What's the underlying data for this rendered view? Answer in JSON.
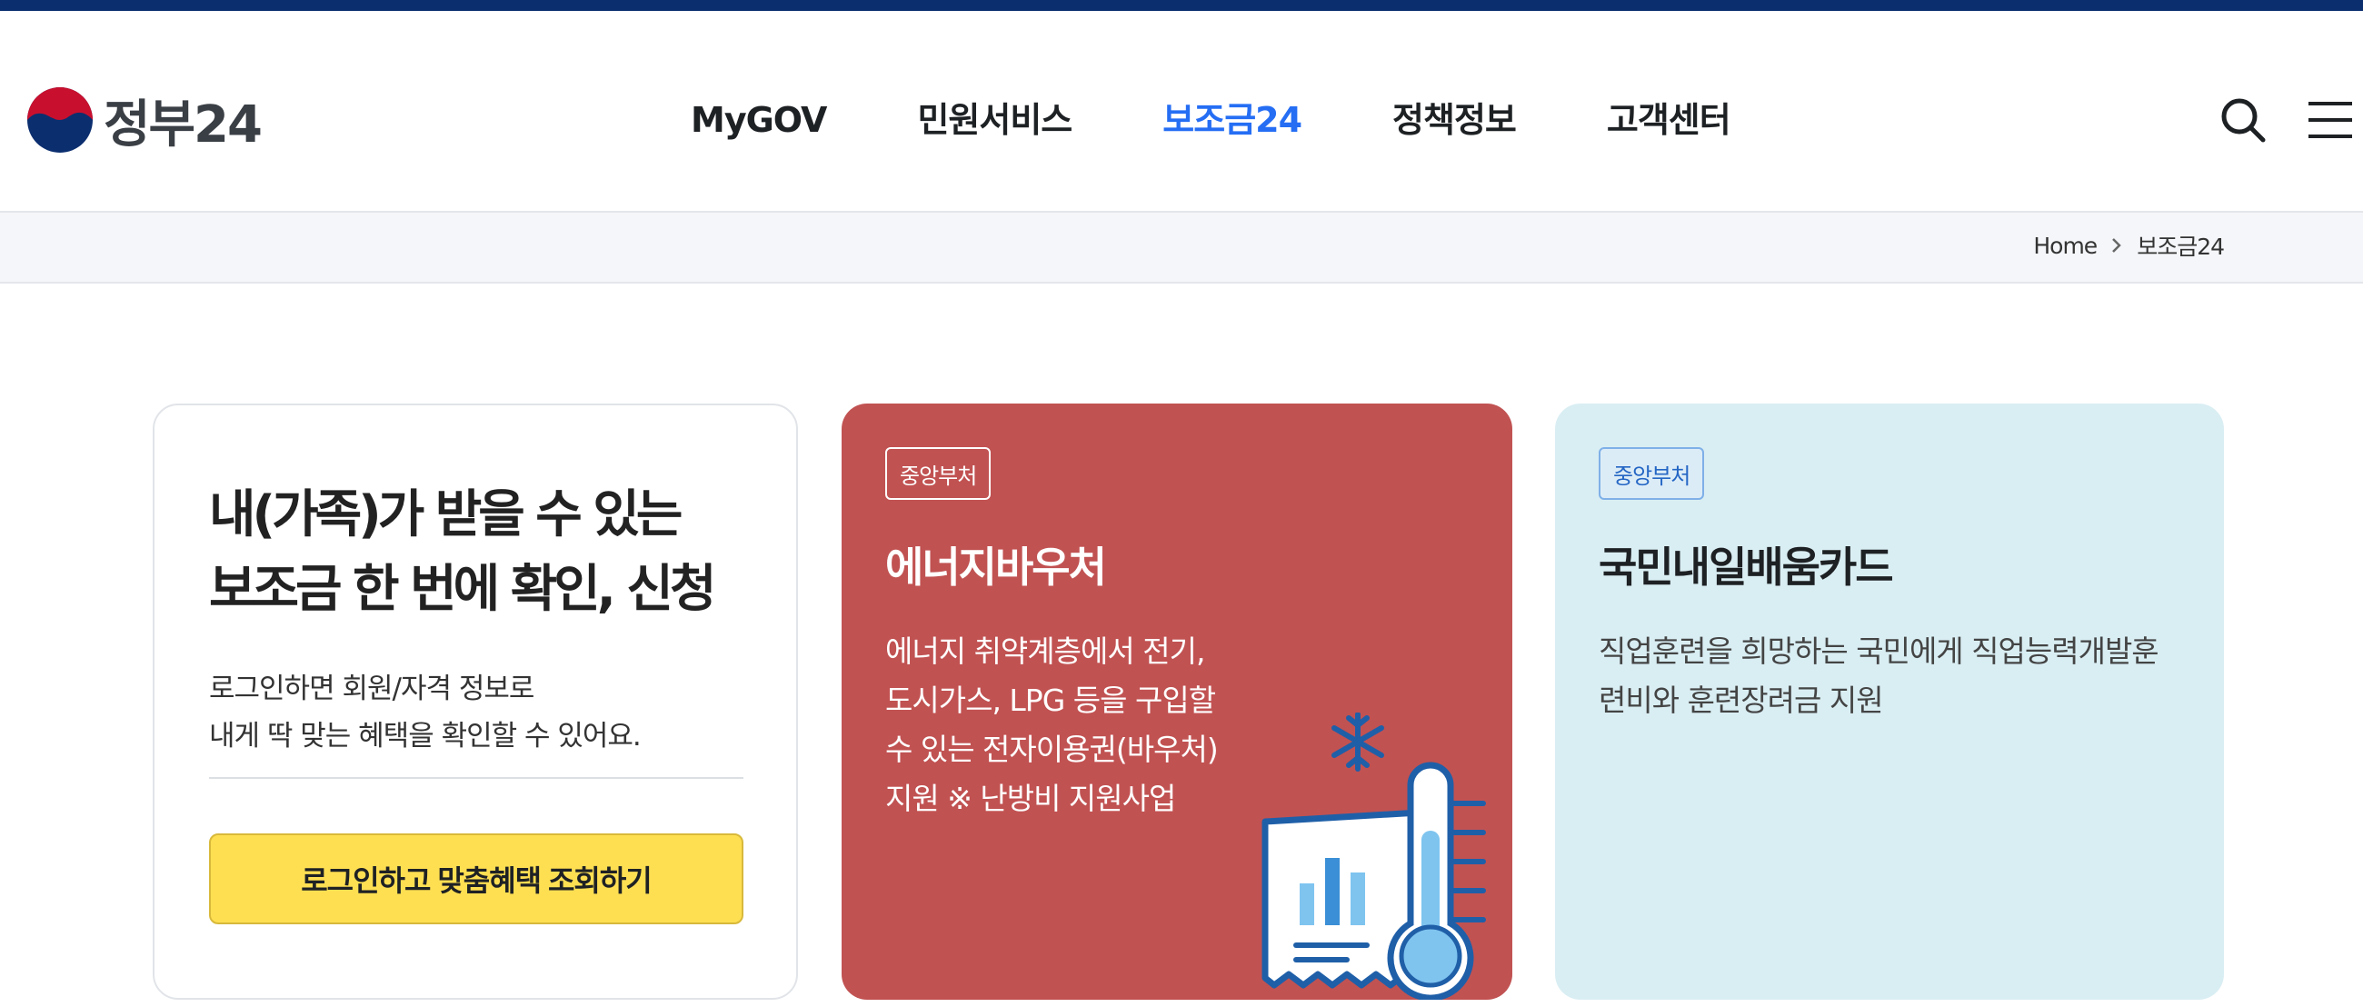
{
  "logo": {
    "text": "정부24",
    "icon": "government-emblem-icon"
  },
  "nav": {
    "items": [
      {
        "label": "MyGOV",
        "active": false
      },
      {
        "label": "민원서비스",
        "active": false
      },
      {
        "label": "보조금24",
        "active": true
      },
      {
        "label": "정책정보",
        "active": false
      },
      {
        "label": "고객센터",
        "active": false
      }
    ],
    "search_icon": "search-icon",
    "menu_icon": "hamburger-menu-icon"
  },
  "breadcrumb": {
    "home": "Home",
    "current": "보조금24"
  },
  "intro": {
    "title_line1": "내(가족)가 받을 수 있는",
    "title_line2": "보조금 한 번에 확인, 신청",
    "desc_line1": "로그인하면 회원/자격 정보로",
    "desc_line2": "내게 딱 맞는 혜택을 확인할 수 있어요.",
    "button_label": "로그인하고 맞춤혜택 조회하기"
  },
  "cards": [
    {
      "tag": "중앙부처",
      "title": "에너지바우처",
      "desc_lines": [
        "에너지 취약계층에서 전기,",
        "도시가스, LPG 등을 구입할",
        "수 있는 전자이용권(바우처)",
        "지원 ※ 난방비 지원사업"
      ],
      "icon": "thermometer-receipt-icon"
    },
    {
      "tag": "중앙부처",
      "title": "국민내일배움카드",
      "desc_lines": [
        "직업훈련을 희망하는 국민에게 직업능력개발훈",
        "련비와 훈련장려금 지원"
      ]
    }
  ],
  "colors": {
    "accent": "#256ef4",
    "top_strip": "#0b2e6f",
    "energy_card": "#c15252",
    "edu_card": "#d9eef3",
    "cta_button": "#ffdf52"
  }
}
